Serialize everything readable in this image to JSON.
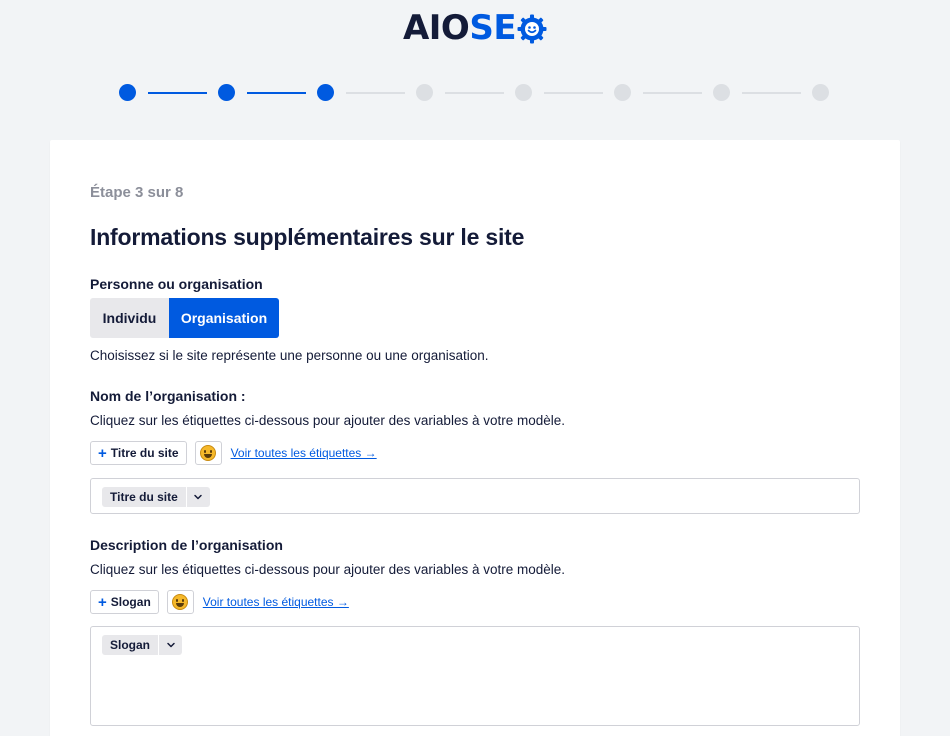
{
  "brand": {
    "part1": "AIO",
    "part2": "SE",
    "accent": "#005ae0",
    "dark": "#141b38"
  },
  "stepper": {
    "current_step": 3,
    "total_steps": 8,
    "active_color": "#005ae0",
    "inactive_color": "#dcdfe3"
  },
  "card": {
    "step_label": "Étape 3 sur 8",
    "title": "Informations supplémentaires sur le site"
  },
  "person_org": {
    "label": "Personne ou organisation",
    "options": [
      "Individu",
      "Organisation"
    ],
    "selected": "Organisation",
    "help": "Choisissez si le site représente une personne ou une organisation."
  },
  "org_name": {
    "label": "Nom de l’organisation :",
    "help": "Cliquez sur les étiquettes ci-dessous pour ajouter des variables à votre modèle.",
    "tag_button": "Titre du site",
    "emoji_icon": "smiley-face-icon",
    "see_all_link": "Voir toutes les étiquettes →",
    "chip": "Titre du site"
  },
  "org_description": {
    "label": "Description de l’organisation",
    "help": "Cliquez sur les étiquettes ci-dessous pour ajouter des variables à votre modèle.",
    "tag_button": "Slogan",
    "emoji_icon": "smiley-face-icon",
    "see_all_link": "Voir toutes les étiquettes →",
    "chip": "Slogan"
  }
}
